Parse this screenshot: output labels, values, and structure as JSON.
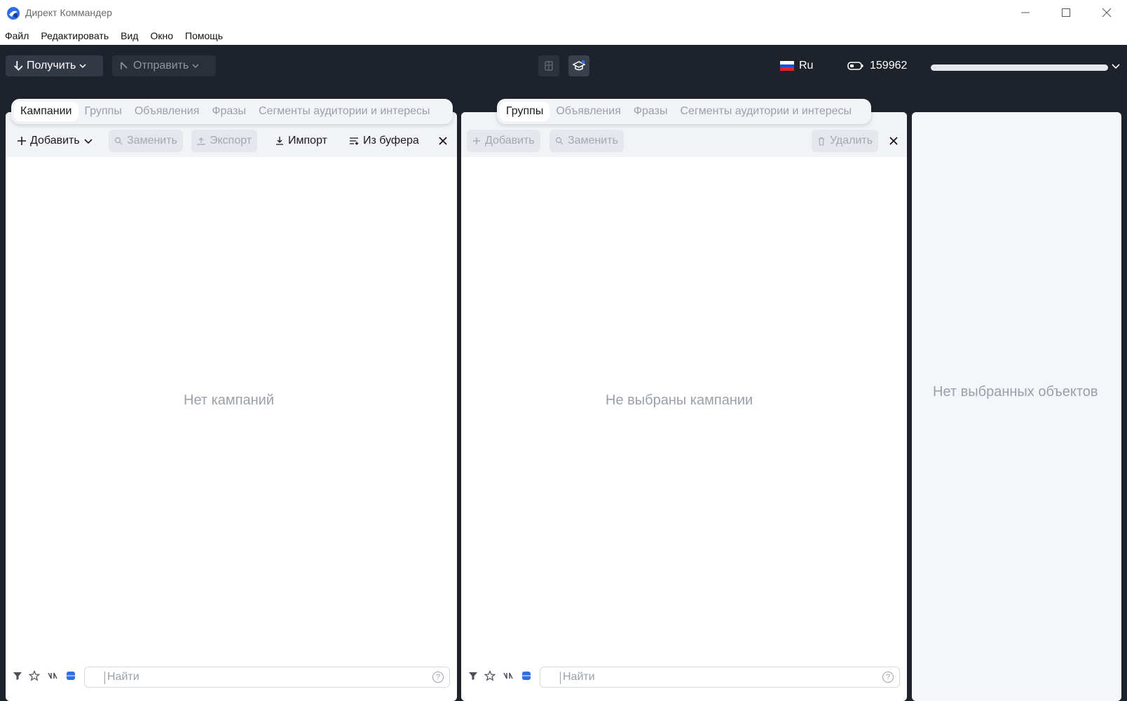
{
  "window": {
    "title": "Директ Коммандер"
  },
  "menu": [
    "Файл",
    "Редактировать",
    "Вид",
    "Окно",
    "Помощь"
  ],
  "toolbar": {
    "get_label": "Получить",
    "send_label": "Отправить",
    "language": "Ru",
    "points": "159962"
  },
  "left_panel": {
    "tabs": [
      "Кампании",
      "Группы",
      "Объявления",
      "Фразы",
      "Сегменты аудитории и интересы"
    ],
    "active_tab": "Кампании",
    "actions": {
      "add": "Добавить",
      "replace": "Заменить",
      "export": "Экспорт",
      "import": "Импорт",
      "from_buffer": "Из буфера"
    },
    "empty_text": "Нет кампаний",
    "search_placeholder": "Найти"
  },
  "middle_panel": {
    "tabs": [
      "Группы",
      "Объявления",
      "Фразы",
      "Сегменты аудитории и интересы"
    ],
    "active_tab": "Группы",
    "actions": {
      "add": "Добавить",
      "replace": "Заменить",
      "delete": "Удалить"
    },
    "empty_text": "Не выбраны кампании",
    "search_placeholder": "Найти"
  },
  "right_panel": {
    "empty_text": "Нет выбранных объектов"
  },
  "colors": {
    "dark_bg": "#1e222a",
    "accent_blue": "#2f6fe4",
    "panel_bg": "#ffffff",
    "muted_text": "#9aa0aa"
  }
}
